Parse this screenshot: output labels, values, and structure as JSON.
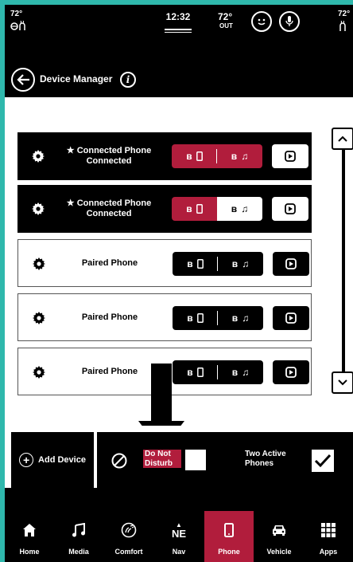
{
  "status_bar": {
    "temp_left": "72°",
    "time": "12:32",
    "outside_temp": "72°",
    "outside_label": "OUT",
    "temp_right": "72°"
  },
  "header": {
    "title": "Device Manager"
  },
  "devices": [
    {
      "name": "Connected Phone",
      "status": "Connected",
      "type": "connected",
      "phone_active": true,
      "audio_active": true
    },
    {
      "name": "Connected Phone",
      "status": "Connected",
      "type": "connected",
      "phone_active": true,
      "audio_active": false
    },
    {
      "name": "Paired Phone",
      "status": "",
      "type": "paired"
    },
    {
      "name": "Paired Phone",
      "status": "",
      "type": "paired"
    },
    {
      "name": "Paired Phone",
      "status": "",
      "type": "paired"
    }
  ],
  "actions": {
    "add_device": "Add Device",
    "dnd_line1": "Do Not",
    "dnd_line2": "Disturb",
    "two_active_line1": "Two Active",
    "two_active_line2": "Phones",
    "dnd_checked": false,
    "two_active_checked": true
  },
  "nav": {
    "items": [
      {
        "label": "Home",
        "icon": "home-icon"
      },
      {
        "label": "Media",
        "icon": "music-note-icon"
      },
      {
        "label": "Comfort",
        "icon": "comfort-icon"
      },
      {
        "label": "Nav",
        "icon": "compass-icon",
        "glyph": "NE"
      },
      {
        "label": "Phone",
        "icon": "phone-icon",
        "active": true
      },
      {
        "label": "Vehicle",
        "icon": "car-icon"
      },
      {
        "label": "Apps",
        "icon": "apps-grid-icon"
      }
    ]
  },
  "colors": {
    "accent": "#b11d3c",
    "background": "#000000",
    "content": "#ffffff",
    "frame": "#2fb8ac"
  }
}
